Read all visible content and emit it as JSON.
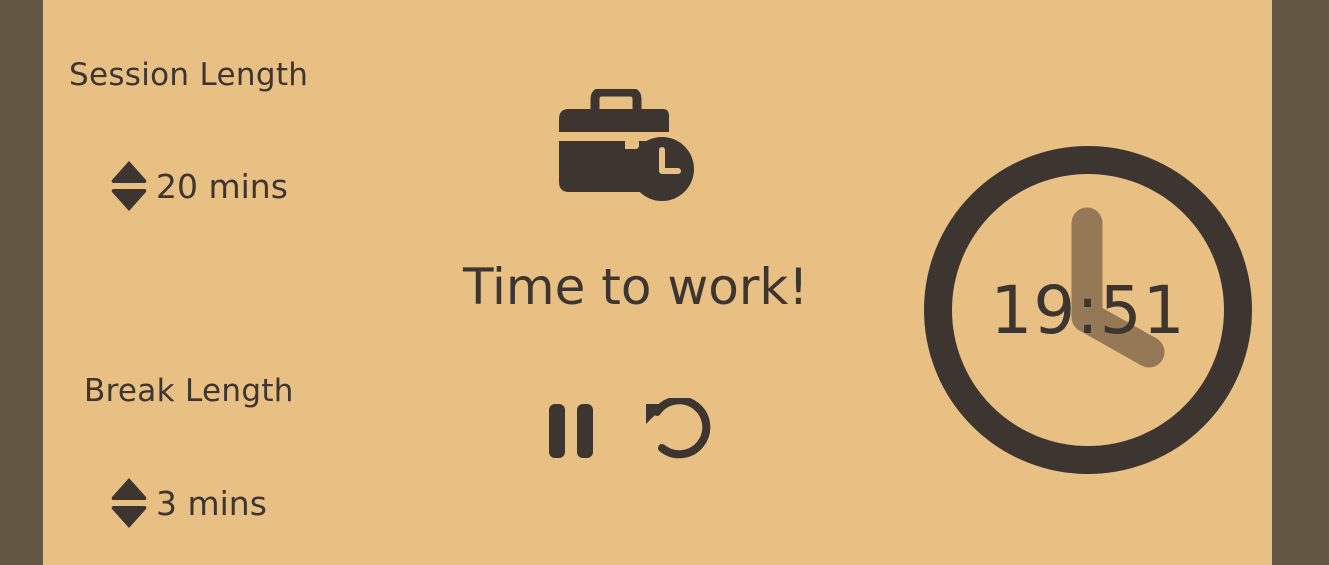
{
  "session": {
    "title": "Session Length",
    "value": "20 mins"
  },
  "break": {
    "title": "Break Length",
    "value": "3 mins"
  },
  "status": {
    "message": "Time to work!",
    "mode_icon": "briefcase-clock-icon"
  },
  "controls": {
    "pause_icon": "pause-icon",
    "reset_icon": "reset-icon"
  },
  "timer": {
    "display": "19:51",
    "icon": "clock-face-icon"
  },
  "colors": {
    "page_border": "#635744",
    "panel_background": "#e8c084",
    "ink": "#3c3530",
    "clock_hand": "#957856"
  }
}
